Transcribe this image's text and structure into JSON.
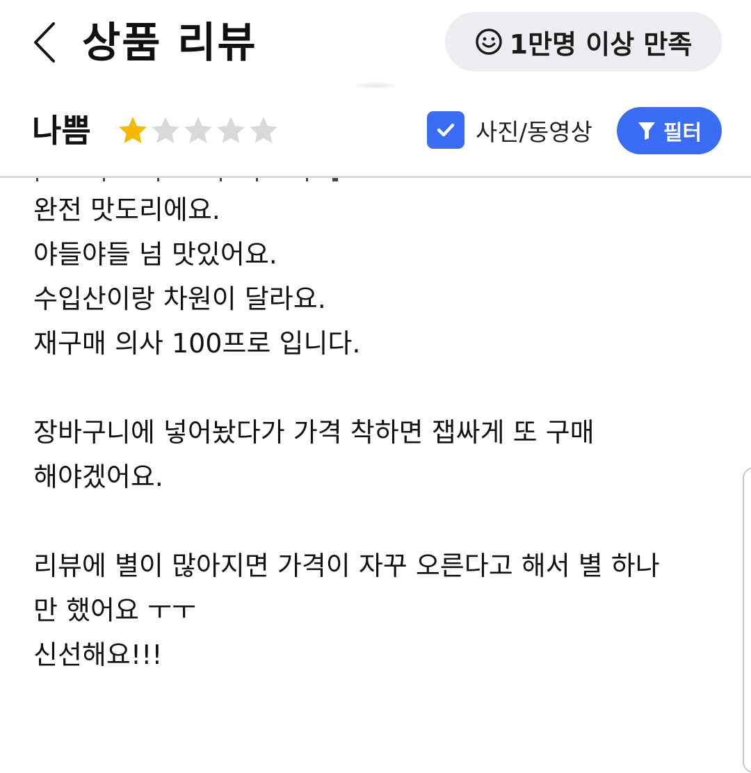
{
  "header": {
    "title": "상품 리뷰",
    "back_icon": "chevron-left-icon",
    "satisfaction_badge": {
      "icon": "smiley-icon",
      "label": "1만명 이상 만족"
    }
  },
  "filter_row": {
    "rating_label": "나쁨",
    "rating": {
      "filled": 1,
      "max": 5
    },
    "star_filled_color": "#f5b800",
    "star_empty_color": "#d9d9d9",
    "photo_video": {
      "checked": true,
      "label": "사진/동영상"
    },
    "filter_button": {
      "icon": "funnel-icon",
      "label": "필터"
    },
    "accent_color": "#3b6cf5"
  },
  "review": {
    "lines": [
      "완전 맛도리에요.",
      "야들야들 넘 맛있어요.",
      "수입산이랑 차원이 달라요.",
      "재구매 의사 100프로 입니다.",
      "",
      "장바구니에 넣어놨다가 가격 착하면 잽싸게 또 구매",
      "해야겠어요.",
      "",
      "리뷰에 별이 많아지면 가격이 자꾸 오른다고 해서 별 하나",
      "만 했어요 ㅜㅜ",
      "신선해요!!!"
    ]
  }
}
